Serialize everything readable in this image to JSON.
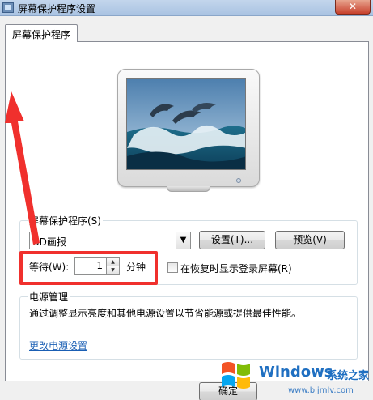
{
  "window": {
    "title": "屏幕保护程序设置",
    "close_label": "✕"
  },
  "tab": {
    "label": "屏幕保护程序"
  },
  "screensaver": {
    "group_label": "屏幕保护程序(S)",
    "selected_value": "3D画报",
    "settings_label": "设置(T)...",
    "preview_label": "预览(V)",
    "wait_label": "等待(W):",
    "wait_value": "1",
    "minutes_label": "分钟",
    "resume_label": "在恢复时显示登录屏幕(R)",
    "resume_checked": false
  },
  "power": {
    "group_label": "电源管理",
    "description": "通过调整显示亮度和其他电源设置以节省能源或提供最佳性能。",
    "link": "更改电源设置"
  },
  "footer": {
    "ok_label": "确定"
  },
  "watermark": {
    "brand": "Windows",
    "site_name": "系统之家",
    "url": "www.bjjmlv.com"
  },
  "colors": {
    "annotation": "#f0302d",
    "link": "#1a5fb4",
    "watermark": "#1f6fc1"
  }
}
